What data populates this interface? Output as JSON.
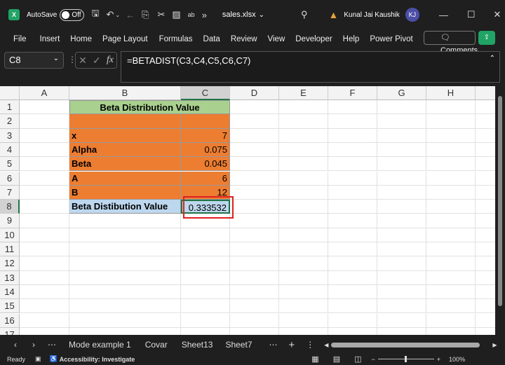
{
  "titlebar": {
    "autosave": "AutoSave",
    "toggle": "Off",
    "filename": "sales.xlsx",
    "user": "Kunal Jai Kaushik",
    "initials": "KJ"
  },
  "menu": [
    "File",
    "Insert",
    "Home",
    "Page Layout",
    "Formulas",
    "Data",
    "Review",
    "View",
    "Developer",
    "Help",
    "Power Pivot"
  ],
  "comments": "Comments",
  "namebox": "C8",
  "formula": "=BETADIST(C3,C4,C5,C6,C7)",
  "columns": [
    "A",
    "B",
    "C",
    "D",
    "E",
    "F",
    "G",
    "H"
  ],
  "rows": [
    "1",
    "2",
    "3",
    "4",
    "5",
    "6",
    "7",
    "8",
    "9",
    "10",
    "11",
    "12",
    "13",
    "14",
    "15",
    "16",
    "17"
  ],
  "table": {
    "title": "Beta Distribution Value",
    "labels": [
      "x",
      "Alpha",
      "Beta",
      "A",
      "B",
      "Beta Distibution Value"
    ],
    "values": [
      "7",
      "0.075",
      "0.045",
      "6",
      "12",
      "0.333532"
    ]
  },
  "colors": {
    "header_green": "#a9d08e",
    "orange": "#ed7d31",
    "result_blue": "#bdd7ee",
    "highlight_red": "#e02020",
    "excel_green": "#21a366"
  },
  "sheets": [
    "Mode example 1",
    "Covar",
    "Sheet13",
    "Sheet7"
  ],
  "status": {
    "ready": "Ready",
    "accessibility": "Accessibility: Investigate",
    "zoom": "100%"
  }
}
